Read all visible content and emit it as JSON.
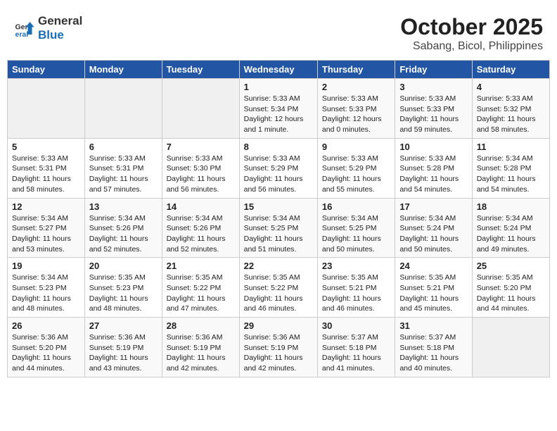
{
  "header": {
    "logo_general": "General",
    "logo_blue": "Blue",
    "month_year": "October 2025",
    "location": "Sabang, Bicol, Philippines"
  },
  "days_of_week": [
    "Sunday",
    "Monday",
    "Tuesday",
    "Wednesday",
    "Thursday",
    "Friday",
    "Saturday"
  ],
  "weeks": [
    [
      {
        "day": "",
        "info": ""
      },
      {
        "day": "",
        "info": ""
      },
      {
        "day": "",
        "info": ""
      },
      {
        "day": "1",
        "info": "Sunrise: 5:33 AM\nSunset: 5:34 PM\nDaylight: 12 hours\nand 1 minute."
      },
      {
        "day": "2",
        "info": "Sunrise: 5:33 AM\nSunset: 5:33 PM\nDaylight: 12 hours\nand 0 minutes."
      },
      {
        "day": "3",
        "info": "Sunrise: 5:33 AM\nSunset: 5:33 PM\nDaylight: 11 hours\nand 59 minutes."
      },
      {
        "day": "4",
        "info": "Sunrise: 5:33 AM\nSunset: 5:32 PM\nDaylight: 11 hours\nand 58 minutes."
      }
    ],
    [
      {
        "day": "5",
        "info": "Sunrise: 5:33 AM\nSunset: 5:31 PM\nDaylight: 11 hours\nand 58 minutes."
      },
      {
        "day": "6",
        "info": "Sunrise: 5:33 AM\nSunset: 5:31 PM\nDaylight: 11 hours\nand 57 minutes."
      },
      {
        "day": "7",
        "info": "Sunrise: 5:33 AM\nSunset: 5:30 PM\nDaylight: 11 hours\nand 56 minutes."
      },
      {
        "day": "8",
        "info": "Sunrise: 5:33 AM\nSunset: 5:29 PM\nDaylight: 11 hours\nand 56 minutes."
      },
      {
        "day": "9",
        "info": "Sunrise: 5:33 AM\nSunset: 5:29 PM\nDaylight: 11 hours\nand 55 minutes."
      },
      {
        "day": "10",
        "info": "Sunrise: 5:33 AM\nSunset: 5:28 PM\nDaylight: 11 hours\nand 54 minutes."
      },
      {
        "day": "11",
        "info": "Sunrise: 5:34 AM\nSunset: 5:28 PM\nDaylight: 11 hours\nand 54 minutes."
      }
    ],
    [
      {
        "day": "12",
        "info": "Sunrise: 5:34 AM\nSunset: 5:27 PM\nDaylight: 11 hours\nand 53 minutes."
      },
      {
        "day": "13",
        "info": "Sunrise: 5:34 AM\nSunset: 5:26 PM\nDaylight: 11 hours\nand 52 minutes."
      },
      {
        "day": "14",
        "info": "Sunrise: 5:34 AM\nSunset: 5:26 PM\nDaylight: 11 hours\nand 52 minutes."
      },
      {
        "day": "15",
        "info": "Sunrise: 5:34 AM\nSunset: 5:25 PM\nDaylight: 11 hours\nand 51 minutes."
      },
      {
        "day": "16",
        "info": "Sunrise: 5:34 AM\nSunset: 5:25 PM\nDaylight: 11 hours\nand 50 minutes."
      },
      {
        "day": "17",
        "info": "Sunrise: 5:34 AM\nSunset: 5:24 PM\nDaylight: 11 hours\nand 50 minutes."
      },
      {
        "day": "18",
        "info": "Sunrise: 5:34 AM\nSunset: 5:24 PM\nDaylight: 11 hours\nand 49 minutes."
      }
    ],
    [
      {
        "day": "19",
        "info": "Sunrise: 5:34 AM\nSunset: 5:23 PM\nDaylight: 11 hours\nand 48 minutes."
      },
      {
        "day": "20",
        "info": "Sunrise: 5:35 AM\nSunset: 5:23 PM\nDaylight: 11 hours\nand 48 minutes."
      },
      {
        "day": "21",
        "info": "Sunrise: 5:35 AM\nSunset: 5:22 PM\nDaylight: 11 hours\nand 47 minutes."
      },
      {
        "day": "22",
        "info": "Sunrise: 5:35 AM\nSunset: 5:22 PM\nDaylight: 11 hours\nand 46 minutes."
      },
      {
        "day": "23",
        "info": "Sunrise: 5:35 AM\nSunset: 5:21 PM\nDaylight: 11 hours\nand 46 minutes."
      },
      {
        "day": "24",
        "info": "Sunrise: 5:35 AM\nSunset: 5:21 PM\nDaylight: 11 hours\nand 45 minutes."
      },
      {
        "day": "25",
        "info": "Sunrise: 5:35 AM\nSunset: 5:20 PM\nDaylight: 11 hours\nand 44 minutes."
      }
    ],
    [
      {
        "day": "26",
        "info": "Sunrise: 5:36 AM\nSunset: 5:20 PM\nDaylight: 11 hours\nand 44 minutes."
      },
      {
        "day": "27",
        "info": "Sunrise: 5:36 AM\nSunset: 5:19 PM\nDaylight: 11 hours\nand 43 minutes."
      },
      {
        "day": "28",
        "info": "Sunrise: 5:36 AM\nSunset: 5:19 PM\nDaylight: 11 hours\nand 42 minutes."
      },
      {
        "day": "29",
        "info": "Sunrise: 5:36 AM\nSunset: 5:19 PM\nDaylight: 11 hours\nand 42 minutes."
      },
      {
        "day": "30",
        "info": "Sunrise: 5:37 AM\nSunset: 5:18 PM\nDaylight: 11 hours\nand 41 minutes."
      },
      {
        "day": "31",
        "info": "Sunrise: 5:37 AM\nSunset: 5:18 PM\nDaylight: 11 hours\nand 40 minutes."
      },
      {
        "day": "",
        "info": ""
      }
    ]
  ]
}
